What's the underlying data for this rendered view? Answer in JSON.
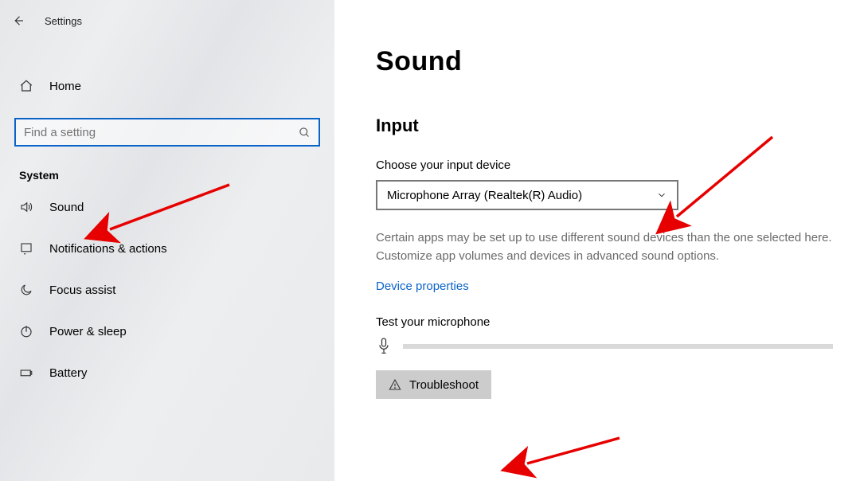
{
  "header": {
    "app_title": "Settings"
  },
  "sidebar": {
    "home_label": "Home",
    "search_placeholder": "Find a setting",
    "section_label": "System",
    "items": [
      {
        "label": "Sound"
      },
      {
        "label": "Notifications & actions"
      },
      {
        "label": "Focus assist"
      },
      {
        "label": "Power & sleep"
      },
      {
        "label": "Battery"
      }
    ]
  },
  "main": {
    "page_title": "Sound",
    "input_heading": "Input",
    "choose_label": "Choose your input device",
    "selected_device": "Microphone Array (Realtek(R) Audio)",
    "description": "Certain apps may be set up to use different sound devices than the one selected here. Customize app volumes and devices in advanced sound options.",
    "device_properties_link": "Device properties",
    "test_label": "Test your microphone",
    "troubleshoot_label": "Troubleshoot"
  }
}
